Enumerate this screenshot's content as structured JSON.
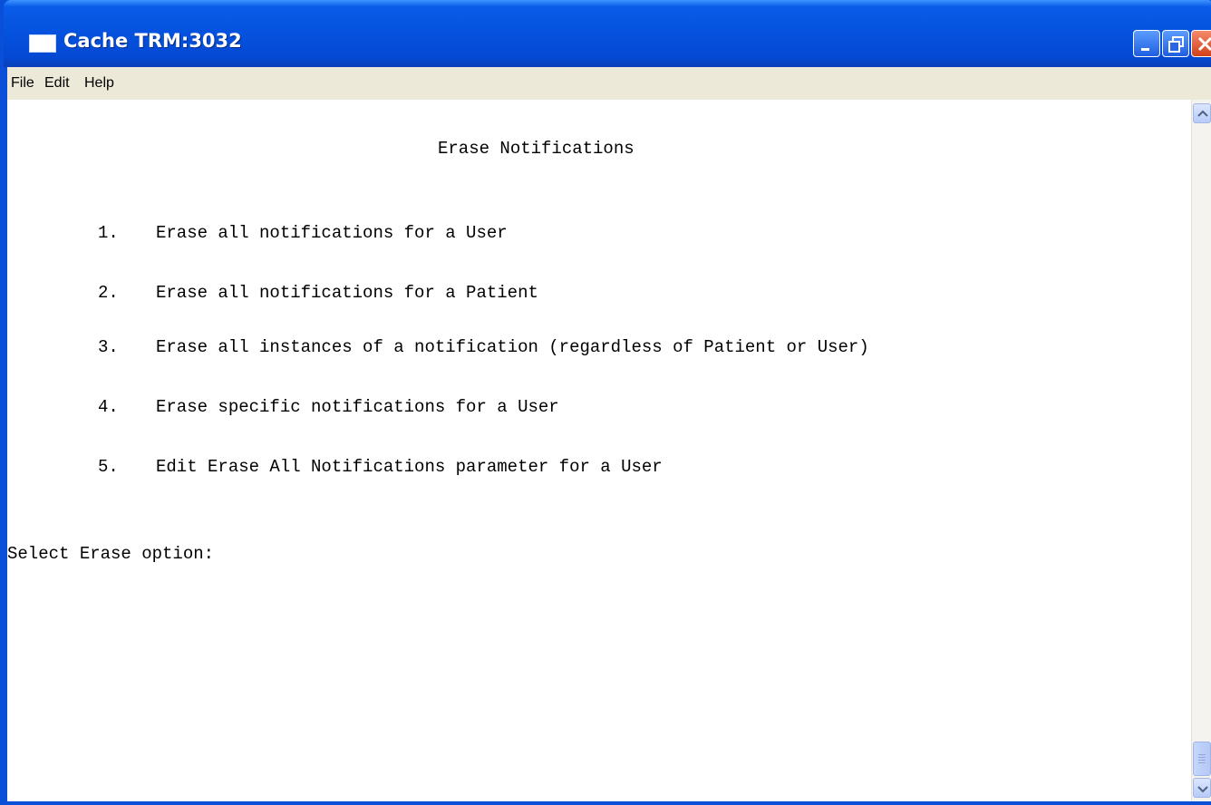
{
  "window": {
    "title": "Cache TRM:3032",
    "icon": "terminal-window-icon",
    "controls": [
      "minimize-icon",
      "restore-icon",
      "close-icon"
    ]
  },
  "menu": {
    "items": [
      "File",
      "Edit",
      "Help"
    ]
  },
  "terminal": {
    "heading": "Erase Notifications",
    "options": [
      {
        "number": "1.",
        "text": "Erase all notifications for a User"
      },
      {
        "number": "2.",
        "text": "Erase all notifications for a Patient"
      },
      {
        "number": "3.",
        "text": "Erase all instances of a notification (regardless of Patient or User)"
      },
      {
        "number": "4.",
        "text": "Erase specific notifications for a User"
      },
      {
        "number": "5.",
        "text": "Edit Erase All Notifications parameter for a User"
      }
    ],
    "prompt": "Select Erase option:",
    "input_value": ""
  },
  "colors": {
    "titlebar": "#0553df",
    "frame": "#0a4fd8",
    "menubar": "#ece9d8",
    "terminal_bg": "#ffffff",
    "close_button": "#d2401c"
  }
}
